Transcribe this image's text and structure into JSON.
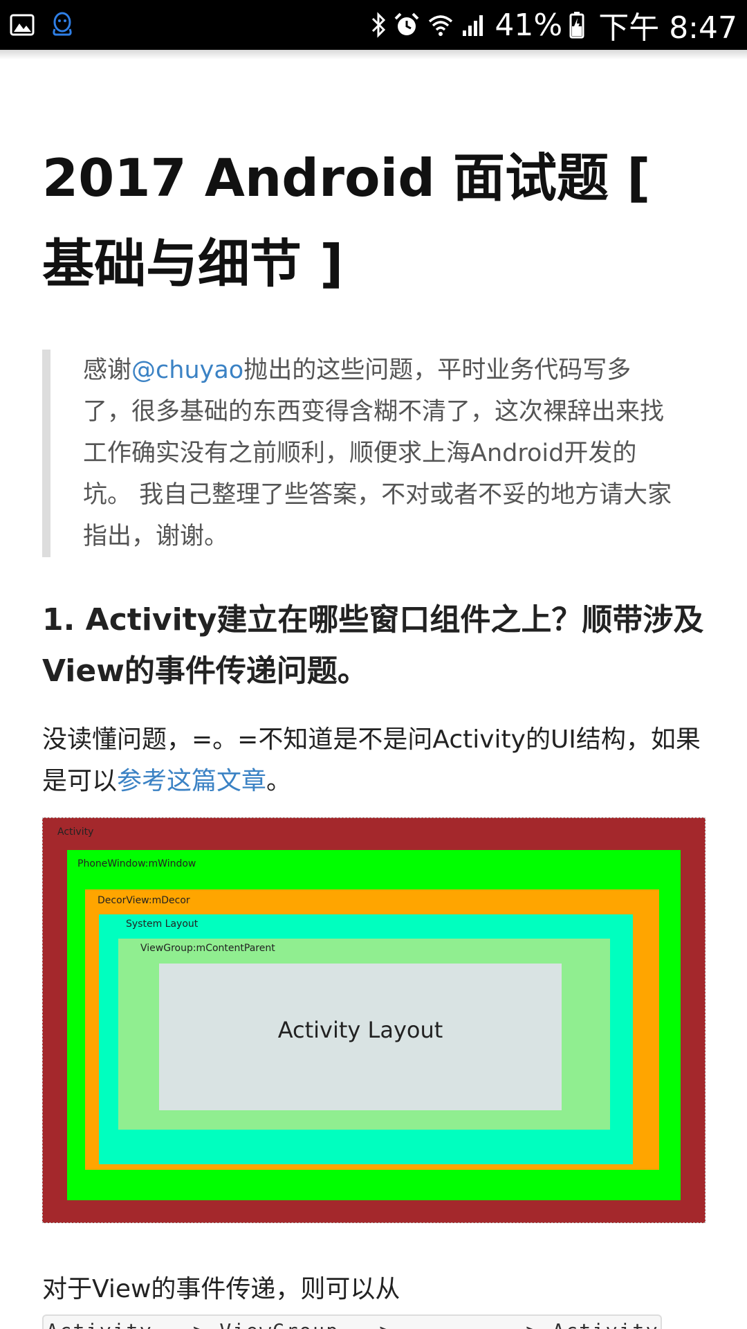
{
  "status_bar": {
    "battery_percent": "41%",
    "time": "下午 8:47",
    "left_icons": [
      "gallery-icon",
      "qq-icon"
    ],
    "right_icons": [
      "bluetooth-icon",
      "alarm-icon",
      "wifi-icon",
      "signal-icon",
      "battery-icon"
    ]
  },
  "article": {
    "title": "2017 Android 面试题 [ 基础与细节 ]",
    "quote": {
      "prefix": "感谢",
      "mention": "@chuyao",
      "text": "抛出的这些问题，平时业务代码写多了，很多基础的东西变得含糊不清了，这次裸辞出来找工作确实没有之前顺利，顺便求上海Android开发的坑。 我自己整理了些答案，不对或者不妥的地方请大家指出，谢谢。"
    },
    "section1": {
      "heading": "1. Activity建立在哪些窗口组件之上？顺带涉及View的事件传递问题。",
      "para_text": "没读懂问题，=。=不知道是不是问Activity的UI结构，如果是可以",
      "para_link": "参考这篇文章",
      "para_end": "。"
    },
    "figure": {
      "labels": {
        "activity": "Activity",
        "phone_window": "PhoneWindow:mWindow",
        "decor_view": "DecorView:mDecor",
        "system_layout": "System Layout",
        "content_parent": "ViewGroup:mContentParent",
        "activity_layout": "Activity Layout"
      },
      "colors": {
        "activity": "#a4282c",
        "phone_window": "#00ff00",
        "decor_view": "#ffa500",
        "system_layout": "#00ffbf",
        "content_parent": "#90ee90",
        "activity_layout": "#d9e3e3"
      }
    },
    "para2": "对于View的事件传递，则可以从",
    "code": "Activity --> ViewGroup --> ...... --> Activity"
  }
}
